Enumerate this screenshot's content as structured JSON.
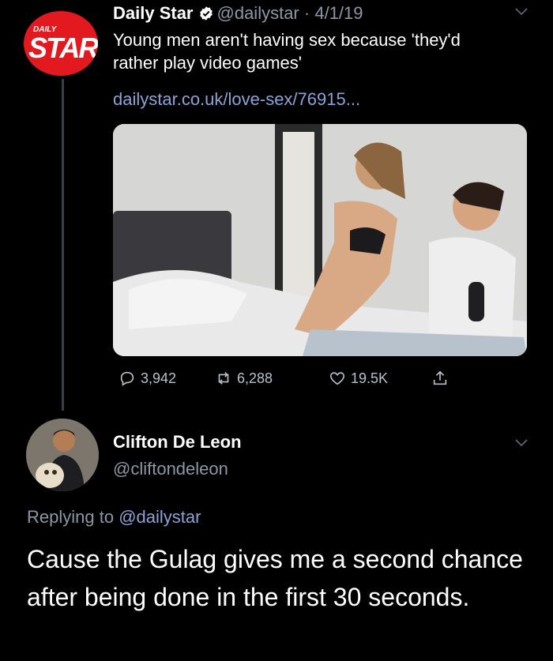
{
  "tweet": {
    "author_name": "Daily Star",
    "author_handle": "@dailystar",
    "separator": "·",
    "date": "4/1/19",
    "avatar_logo_top": "DAILY",
    "avatar_logo_main": "STAR",
    "text": "Young men aren't having sex because 'they'd rather play video games'",
    "link": "dailystar.co.uk/love-sex/76915...",
    "stats": {
      "replies": "3,942",
      "retweets": "6,288",
      "likes": "19.5K"
    }
  },
  "reply": {
    "author_name": "Clifton De Leon",
    "author_handle": "@cliftondeleon",
    "replying_prefix": "Replying to",
    "replying_to": "@dailystar",
    "text": "Cause the Gulag gives me a second chance after being done in the first 30 seconds."
  },
  "colors": {
    "background": "#000000",
    "link": "#8da2d6",
    "muted": "#8b98a5",
    "brand_red": "#e2191e"
  },
  "icons": [
    "verified-icon",
    "chevron-down-icon",
    "reply-icon",
    "retweet-icon",
    "like-icon",
    "share-icon"
  ]
}
